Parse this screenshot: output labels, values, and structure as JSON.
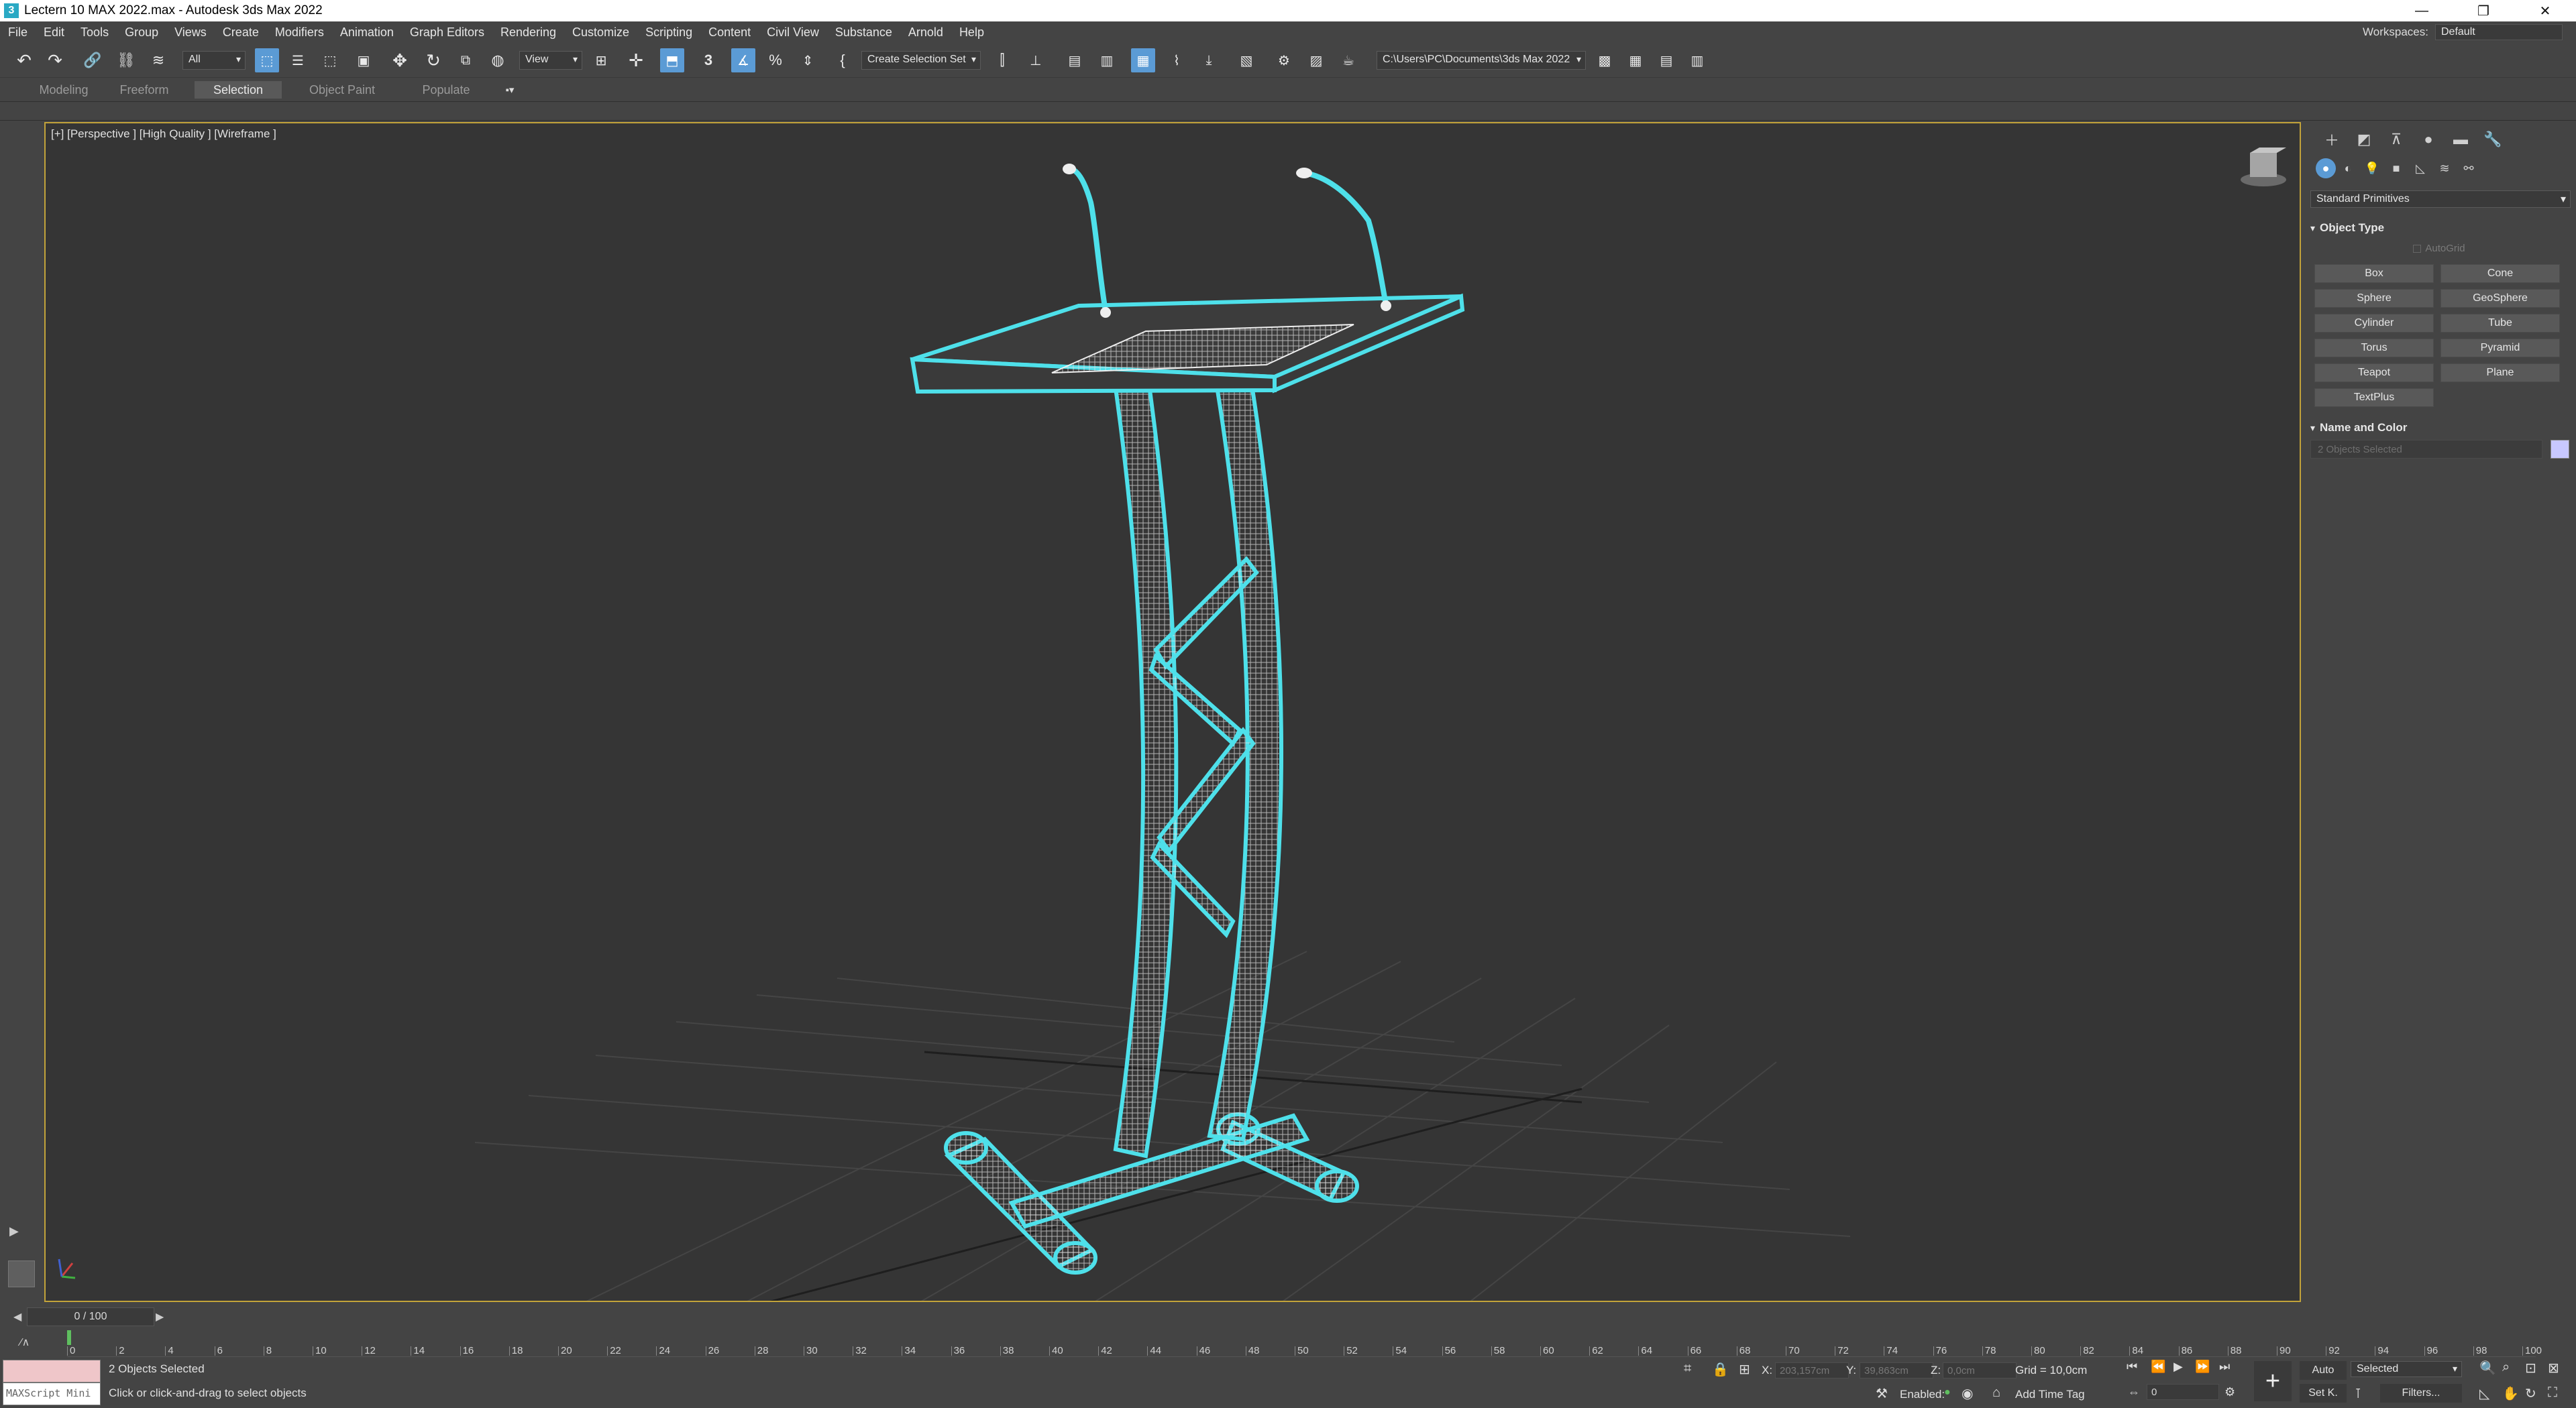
{
  "window": {
    "title": "Lectern 10 MAX 2022.max - Autodesk 3ds Max 2022",
    "app_icon": "3",
    "minimize": "—",
    "restore": "❐",
    "close": "✕"
  },
  "menu": [
    "File",
    "Edit",
    "Tools",
    "Group",
    "Views",
    "Create",
    "Modifiers",
    "Animation",
    "Graph Editors",
    "Rendering",
    "Customize",
    "Scripting",
    "Content",
    "Civil View",
    "Substance",
    "Arnold",
    "Help"
  ],
  "workspaces": {
    "label": "Workspaces:",
    "value": "Default"
  },
  "toolbar": {
    "selection_filter": "All",
    "ref_coord": "View",
    "selection_set": "Create Selection Set",
    "project_path": "C:\\Users\\PC\\Documents\\3ds Max 2022",
    "snap_label": "3"
  },
  "ribbon_tabs": [
    "Modeling",
    "Freeform",
    "Selection",
    "Object Paint",
    "Populate"
  ],
  "active_ribbon_tab": "Selection",
  "viewport": {
    "label": "[+] [Perspective ] [High Quality ] [Wireframe ]"
  },
  "command_panel": {
    "category": "Standard Primitives",
    "object_type_title": "Object Type",
    "autogrid": "AutoGrid",
    "primitives": [
      [
        "Box",
        "Cone"
      ],
      [
        "Sphere",
        "GeoSphere"
      ],
      [
        "Cylinder",
        "Tube"
      ],
      [
        "Torus",
        "Pyramid"
      ],
      [
        "Teapot",
        "Plane"
      ],
      [
        "TextPlus",
        ""
      ]
    ],
    "name_color_title": "Name and Color",
    "name_value": "2 Objects Selected",
    "color": "#c8c8ff"
  },
  "timeline": {
    "frame_display": "0 / 100",
    "ticks": [
      "0",
      "2",
      "4",
      "6",
      "8",
      "10",
      "12",
      "14",
      "16",
      "18",
      "20",
      "22",
      "24",
      "26",
      "28",
      "30",
      "32",
      "34",
      "36",
      "38",
      "40",
      "42",
      "44",
      "46",
      "48",
      "50",
      "52",
      "54",
      "56",
      "58",
      "60",
      "62",
      "64",
      "66",
      "68",
      "70",
      "72",
      "74",
      "76",
      "78",
      "80",
      "82",
      "84",
      "86",
      "88",
      "90",
      "92",
      "94",
      "96",
      "98",
      "100"
    ]
  },
  "status": {
    "maxscript": "MAXScript Mini",
    "selection": "2 Objects Selected",
    "prompt": "Click or click-and-drag to select objects",
    "x_label": "X:",
    "x_value": "203,157cm",
    "y_label": "Y:",
    "y_value": "39,863cm",
    "z_label": "Z:",
    "z_value": "0,0cm",
    "grid": "Grid = 10,0cm",
    "enabled_label": "Enabled:",
    "add_time_tag": "Add Time Tag",
    "auto": "Auto",
    "set_key": "Set K.",
    "key_filter": "Selected",
    "filters": "Filters...",
    "frame_value": "0"
  },
  "colors": {
    "selection_cyan": "#4ee0ea",
    "viewport_border": "#c2a33a",
    "active_blue": "#5b9bd5"
  }
}
